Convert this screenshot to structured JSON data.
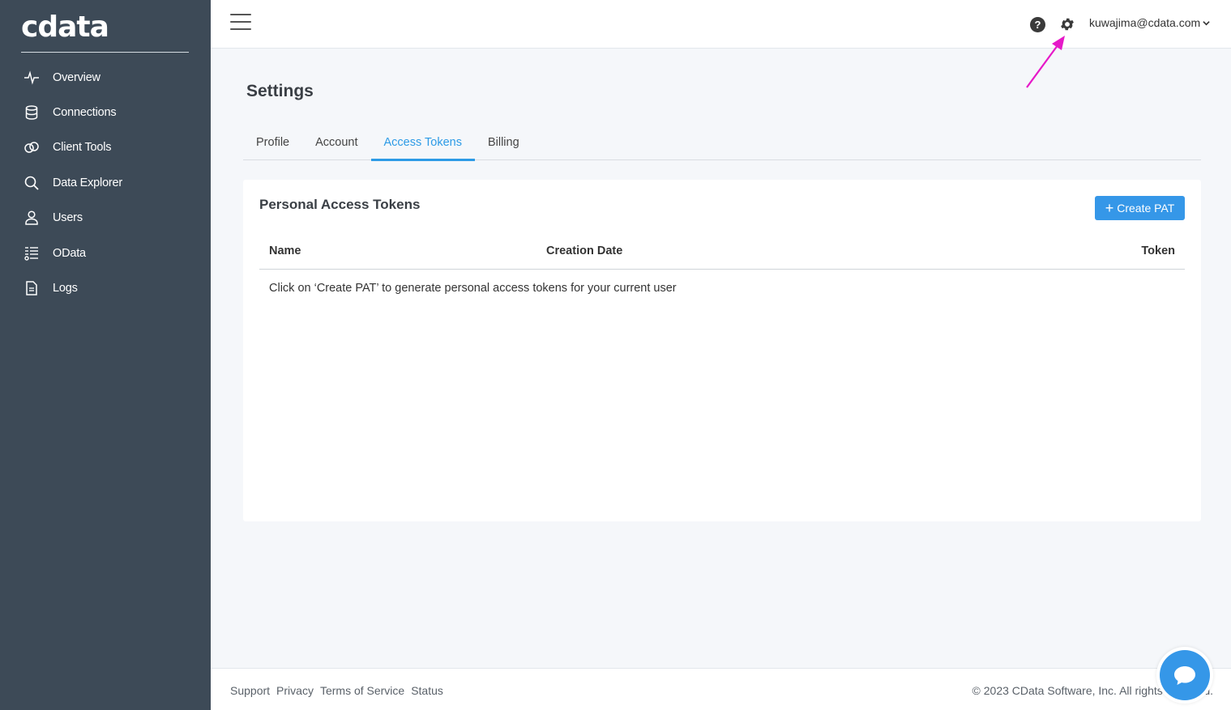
{
  "brand": {
    "logo_text": "cdata",
    "accent": "#3597e8",
    "sidebar_bg": "#3d4a57"
  },
  "sidebar": {
    "items": [
      {
        "label": "Overview",
        "icon": "pulse-icon"
      },
      {
        "label": "Connections",
        "icon": "database-icon"
      },
      {
        "label": "Client Tools",
        "icon": "link-icon"
      },
      {
        "label": "Data Explorer",
        "icon": "search-icon"
      },
      {
        "label": "Users",
        "icon": "user-icon"
      },
      {
        "label": "OData",
        "icon": "odata-icon"
      },
      {
        "label": "Logs",
        "icon": "document-icon"
      }
    ]
  },
  "topbar": {
    "help_glyph": "?",
    "user_email": "kuwajima@cdata.com"
  },
  "page": {
    "title": "Settings",
    "tabs": [
      {
        "label": "Profile",
        "active": false
      },
      {
        "label": "Account",
        "active": false
      },
      {
        "label": "Access Tokens",
        "active": true
      },
      {
        "label": "Billing",
        "active": false
      }
    ]
  },
  "tokens_card": {
    "title": "Personal Access Tokens",
    "create_button": "Create PAT",
    "columns": [
      "Name",
      "Creation Date",
      "Token"
    ],
    "empty_message": "Click on ‘Create PAT’ to generate personal access tokens for your current user"
  },
  "footer": {
    "links": [
      "Support",
      "Privacy",
      "Terms of Service",
      "Status"
    ],
    "copyright": "© 2023 CData Software, Inc. All rights reserved."
  },
  "annotation_color": "#e619c8"
}
